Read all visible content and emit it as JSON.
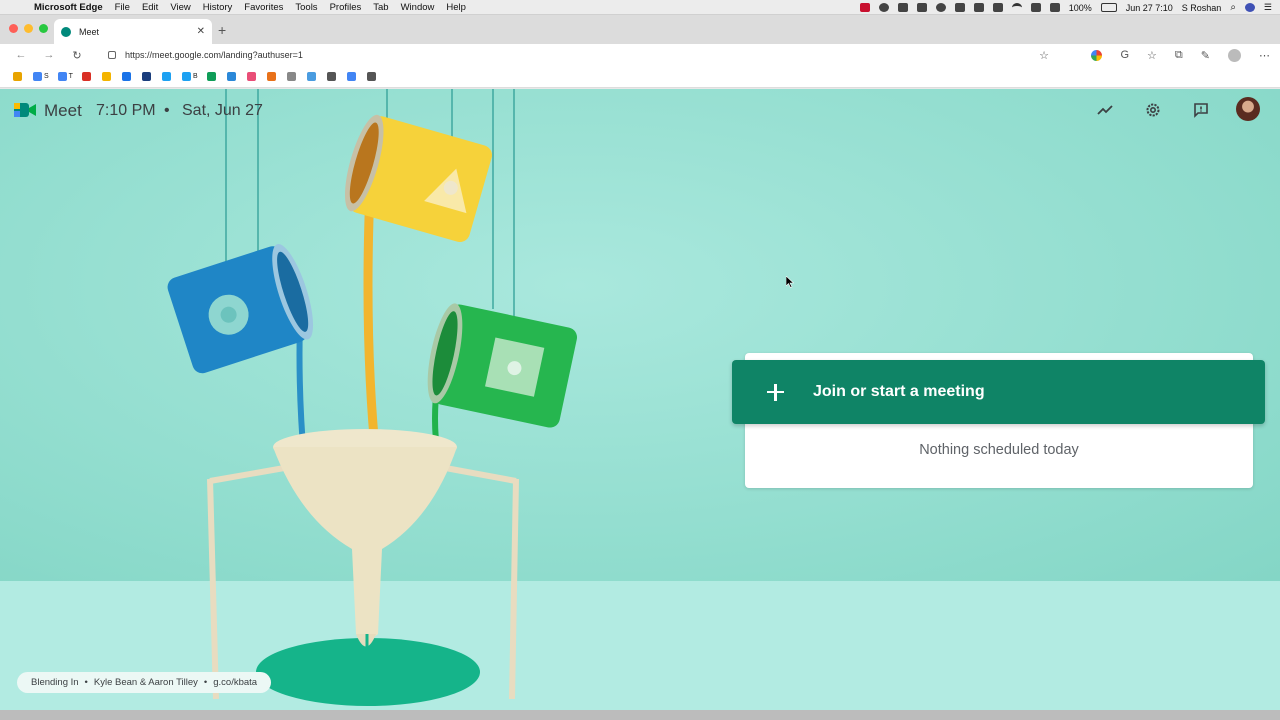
{
  "menubar": {
    "app": "Microsoft Edge",
    "items": [
      "File",
      "Edit",
      "View",
      "History",
      "Favorites",
      "Tools",
      "Profiles",
      "Tab",
      "Window",
      "Help"
    ],
    "battery": "100%",
    "datetime": "Jun 27  7:10",
    "user": "S Roshan"
  },
  "browser": {
    "tab_title": "Meet",
    "url": "https://meet.google.com/landing?authuser=1"
  },
  "favorites": [
    {
      "icon": "folder-icon",
      "label": "",
      "color": "#e8a400"
    },
    {
      "icon": "docs-icon",
      "label": "S",
      "color": "#4285f4"
    },
    {
      "icon": "docs-icon",
      "label": "T",
      "color": "#4285f4"
    },
    {
      "icon": "pdf-icon",
      "label": "",
      "color": "#d93025"
    },
    {
      "icon": "slides-icon",
      "label": "",
      "color": "#f4b400"
    },
    {
      "icon": "calendar-icon",
      "label": "",
      "color": "#1a73e8"
    },
    {
      "icon": "p-icon",
      "label": "",
      "color": "#1a3d7c"
    },
    {
      "icon": "twitter-icon",
      "label": "",
      "color": "#1da1f2"
    },
    {
      "icon": "twitter-icon",
      "label": "B",
      "color": "#1da1f2"
    },
    {
      "icon": "sheets-icon",
      "label": "",
      "color": "#0f9d58"
    },
    {
      "icon": "teams-icon",
      "label": "",
      "color": "#2b88d8"
    },
    {
      "icon": "pinwheel-icon",
      "label": "",
      "color": "#e94e77"
    },
    {
      "icon": "c-icon",
      "label": "",
      "color": "#e8711a"
    },
    {
      "icon": "gear-icon",
      "label": "",
      "color": "#888888"
    },
    {
      "icon": "sparkle-icon",
      "label": "",
      "color": "#4a9ce0"
    },
    {
      "icon": "circle-icon",
      "label": "",
      "color": "#555555"
    },
    {
      "icon": "google-icon",
      "label": "",
      "color": "#4285f4"
    },
    {
      "icon": "list-icon",
      "label": "",
      "color": "#555555"
    }
  ],
  "meet": {
    "title": "Meet",
    "time": "7:10 PM",
    "separator": "•",
    "date": "Sat, Jun 27",
    "join_label": "Join or start a meeting",
    "empty_label": "Nothing scheduled today",
    "credit": [
      "Blending In",
      "•",
      "Kyle Bean & Aaron Tilley",
      "•",
      "g.co/kbata"
    ],
    "accent": "#0f8466"
  }
}
